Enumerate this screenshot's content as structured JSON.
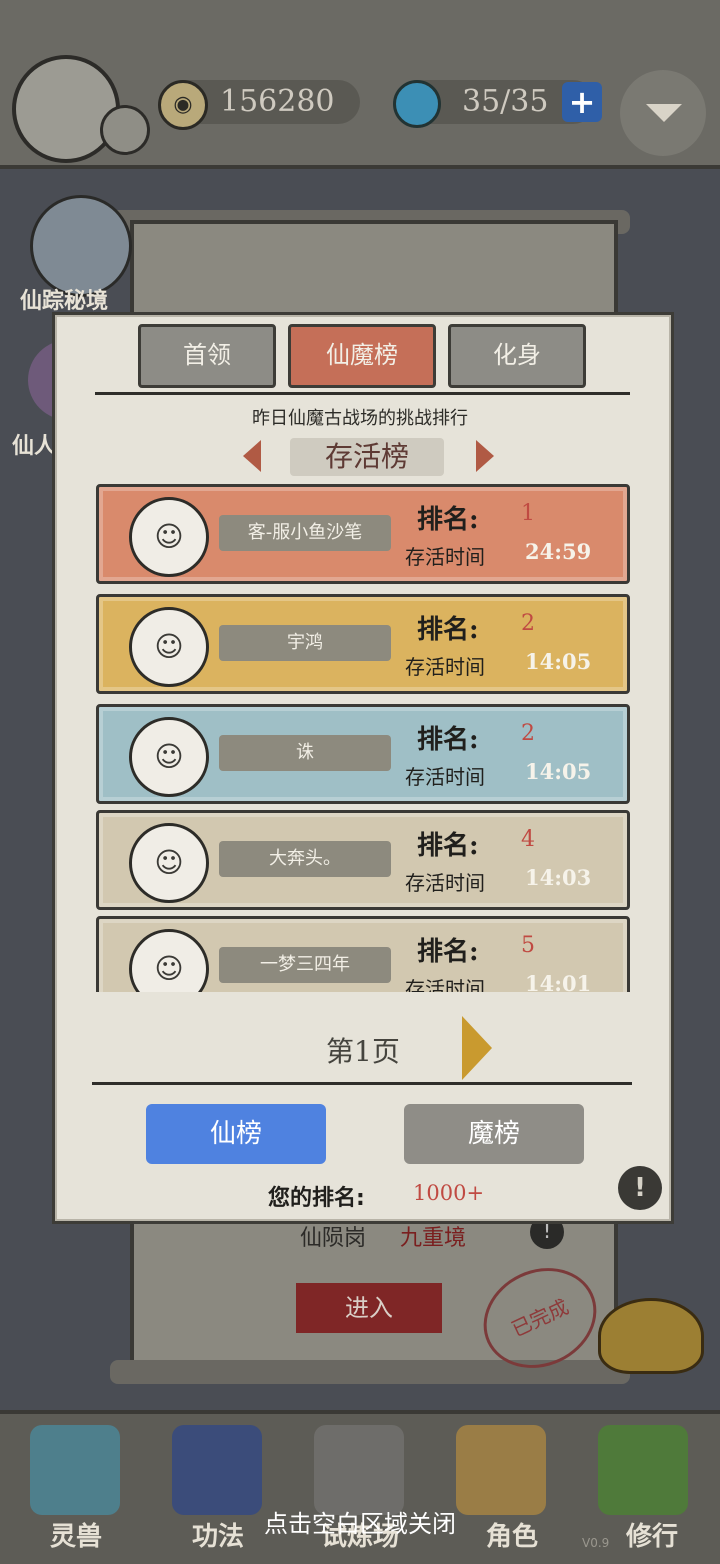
{
  "topbar": {
    "coins": "156280",
    "stamina": "35/35",
    "plus_icon": "+"
  },
  "side": {
    "secret_realm_label": "仙踪秘境",
    "second_label": "仙人"
  },
  "background_panel": {
    "realm_label": "仙陨岗",
    "realm_sub": "九重境",
    "enter_label": "进入",
    "stamp_label": "已完成"
  },
  "modal": {
    "tabs": [
      {
        "label": "首领"
      },
      {
        "label": "仙魔榜"
      },
      {
        "label": "化身"
      }
    ],
    "subtitle": "昨日仙魔古战场的挑战排行",
    "board_title": "存活榜",
    "rank_label": "排名:",
    "time_label": "存活时间",
    "entries": [
      {
        "name": "客-服小鱼沙笔",
        "rank": "1",
        "time": "24:59",
        "color": "#d98a6c"
      },
      {
        "name": "宇鸿",
        "rank": "2",
        "time": "14:05",
        "color": "#dbb35f"
      },
      {
        "name": "诛",
        "rank": "2",
        "time": "14:05",
        "color": "#9fbfc6"
      },
      {
        "name": "大奔头。",
        "rank": "4",
        "time": "14:03",
        "color": "#d2c8b0"
      },
      {
        "name": "一梦三四年",
        "rank": "5",
        "time": "14:01",
        "color": "#d2c8b0"
      }
    ],
    "page_label": "第1页",
    "btn_xian": "仙榜",
    "btn_mo": "魔榜",
    "my_rank_label": "您的排名:",
    "my_rank_value": "1000+"
  },
  "bottom_nav": [
    {
      "label": "灵兽"
    },
    {
      "label": "功法"
    },
    {
      "label": "试炼场"
    },
    {
      "label": "角色"
    },
    {
      "label": "修行"
    }
  ],
  "close_hint": "点击空白区域关闭",
  "version": "V0.9"
}
